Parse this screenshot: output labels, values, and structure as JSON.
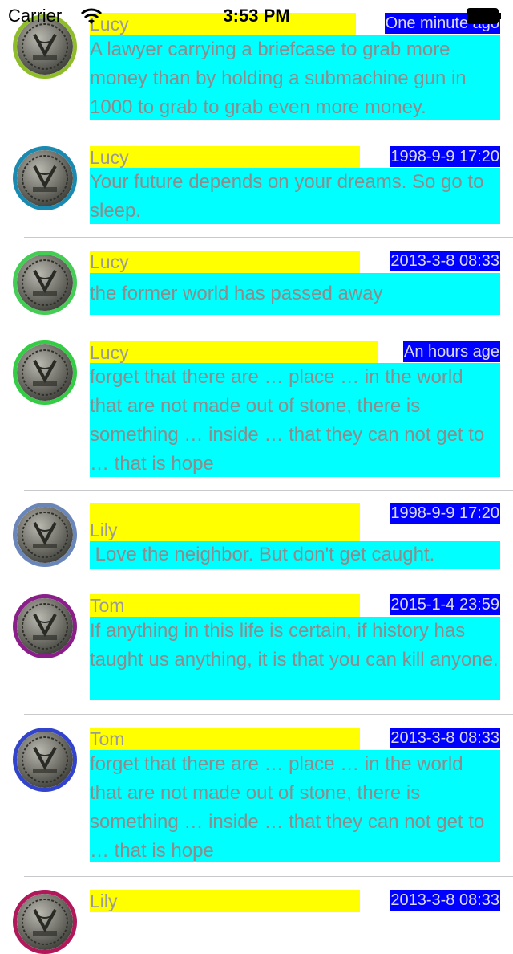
{
  "status_bar": {
    "carrier": "Carrier",
    "time": "3:53 PM"
  },
  "feed": [
    {
      "name": "Lucy",
      "time": "One minute ago",
      "ring": "#8fbc2a",
      "text": "A lawyer carrying a briefcase to grab more money than by holding a submachine gun in 1000 to grab to grab even more money."
    },
    {
      "name": "Lucy",
      "time": "1998-9-9 17:20",
      "ring": "#1a8ab0",
      "text": "Your future depends on your dreams. So go to sleep."
    },
    {
      "name": "Lucy",
      "time": "2013-3-8 08:33",
      "ring": "#44cc55",
      "text": "the former world has passed away"
    },
    {
      "name": "Lucy",
      "time": "An hours age",
      "ring": "#33cc44",
      "text": "forget that there are … place … in the world that are not made out of stone, there is something … inside … that they can not get to … that is hope"
    },
    {
      "name": "Lily",
      "time": "1998-9-9 17:20",
      "ring": "#6a86b8",
      "text": " Love the neighbor. But don't get caught."
    },
    {
      "name": "Tom",
      "time": "2015-1-4 23:59",
      "ring": "#8a1f8a",
      "text": "If anything in this life is certain, if history has taught us anything, it is that you can kill anyone."
    },
    {
      "name": "Tom",
      "time": "2013-3-8 08:33",
      "ring": "#3344cc",
      "text": "forget that there are … place … in the world that are not made out of stone, there is something … inside … that they can not get to … that is hope"
    },
    {
      "name": "Lily",
      "time": "2013-3-8 08:33",
      "ring": "#b0185a",
      "text": ""
    }
  ]
}
